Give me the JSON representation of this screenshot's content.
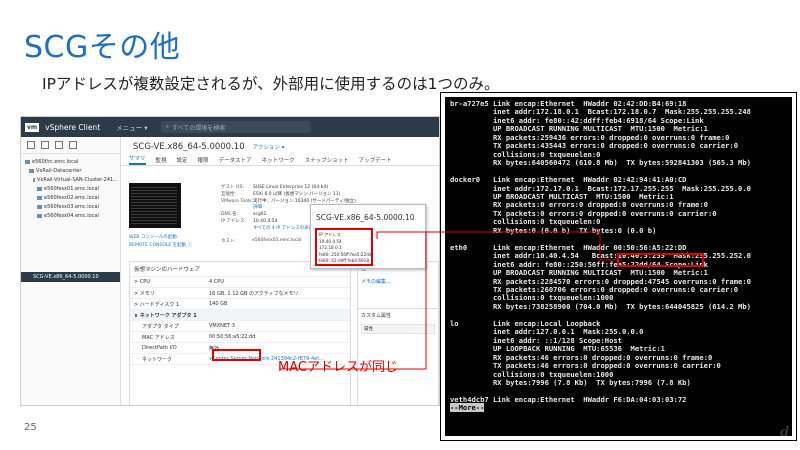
{
  "slide": {
    "title": "SCGその他",
    "subtitle": "IPアドレスが複数設定されるが、外部用に使用するのは1つのみ。",
    "page_number": "25",
    "annotation": "MACアドレスが同じ",
    "footer_glyph": "d"
  },
  "vsphere": {
    "logo": "vm",
    "app_name": "vSphere Client",
    "menu": "メニュー ▾",
    "search_placeholder": "すべての環境を検索",
    "tree": [
      "e560f/rc.emc.local",
      "VxRail-Datacenter",
      "VxRail-Virtual-SAN-Cluster-241...",
      "e560fesx01.emc.local",
      "e560fesx02.emc.local",
      "e560fesx03.emc.local",
      "e560fesx04.emc.local"
    ],
    "selected_vm": "SCG-VE.x86_64-5.0000.10",
    "vm_title": "SCG-VE.x86_64-5.0000.10",
    "actions": "アクション ▾",
    "tabs": [
      "サマリ",
      "監視",
      "設定",
      "権限",
      "データストア",
      "ネットワーク",
      "スナップショット",
      "アップデート"
    ],
    "web_console": "WEB コンソールの起動",
    "remote_console": "REMOTE CONSOLE を起動 ⓘ",
    "summary": [
      {
        "k": "ゲスト OS:",
        "v": "SUSE Linux Enterprise 12 (64-bit)"
      },
      {
        "k": "互換性:",
        "v": "ESXi 6.0 以降 (仮想マシン バージョン 11)"
      },
      {
        "k": "VMware Tools:",
        "v": "実行中、バージョン:10340 (サードパーティ/独立)"
      },
      {
        "k": "",
        "v": "詳細"
      },
      {
        "k": "DNS 名:",
        "v": "scg01"
      },
      {
        "k": "IP アドレス:",
        "v": "10.40.4.54"
      },
      {
        "k": "",
        "v": "すべての 4 IP アドレスの表示"
      }
    ],
    "host_label": "ホスト:",
    "host_value": "e560fesx03.emc.local",
    "hw_title": "仮想マシンのハードウェア",
    "hw_rows": [
      {
        "k": "> CPU",
        "v": "4 CPU"
      },
      {
        "k": "> メモリ",
        "v": "16 GB, 1.12 GB のアクティブなメモリ"
      },
      {
        "k": "> ハードディスク 1",
        "v": "140 GB"
      },
      {
        "k": "∨ ネットワーク アダプタ 1",
        "v": ""
      },
      {
        "k": "アダプタ タイプ",
        "v": "VMXNET 3"
      },
      {
        "k": "MAC アドレス",
        "v": "00:50:56:a5:22:dd"
      },
      {
        "k": "DirectPath I/O",
        "v": "無効"
      },
      {
        "k": "ネットワーク",
        "v": "vCenter Server Network-241394c2-f879-4ef..."
      }
    ],
    "side_note": "注",
    "side_edit": "メモの編集...",
    "side_custom": "カスタム属性",
    "side_attr": "属性",
    "popup_title": "SCG-VE.x86_64-5.0000.10",
    "popup_lines": [
      "IP アドレス",
      "10.40.4.54",
      "172.18.0.1",
      "fe80::250:56ff:fea5:22dd",
      "fe80::42:ddff:feb4:6918"
    ]
  },
  "terminal": {
    "lines": [
      "br-a727e5 Link encap:Ethernet  HWaddr 02:42:DD:B4:69:18",
      "          inet addr:172.18.0.1  Bcast:172.18.0.7  Mask:255.255.255.248",
      "          inet6 addr: fe80::42:ddff:feb4:6918/64 Scope:Link",
      "          UP BROADCAST RUNNING MULTICAST  MTU:1500  Metric:1",
      "          RX packets:259436 errors:0 dropped:0 overruns:0 frame:0",
      "          TX packets:435443 errors:0 dropped:0 overruns:0 carrier:0",
      "          collisions:0 txqueuelen:0",
      "          RX bytes:640560472 (610.8 Mb)  TX bytes:592841303 (565.3 Mb)",
      "",
      "docker0   Link encap:Ethernet  HWaddr 02:42:94:41:A0:CD",
      "          inet addr:172.17.0.1  Bcast:172.17.255.255  Mask:255.255.0.0",
      "          UP BROADCAST MULTICAST  MTU:1500  Metric:1",
      "          RX packets:0 errors:0 dropped:0 overruns:0 frame:0",
      "          TX packets:0 errors:0 dropped:0 overruns:0 carrier:0",
      "          collisions:0 txqueuelen:0",
      "          RX bytes:0 (0.0 b)  TX bytes:0 (0.0 b)",
      "",
      "eth0      Link encap:Ethernet  HWaddr 00:50:56:A5:22:DD",
      "          inet addr:10.40.4.54   Bcast:10.40.5.255  Mask:255.255.252.0",
      "          inet6 addr: fe80::250:56ff:fea5:22dd/64 Scope:Link",
      "          UP BROADCAST RUNNING MULTICAST  MTU:1500  Metric:1",
      "          RX packets:2284570 errors:0 dropped:47545 overruns:0 frame:0",
      "          TX packets:260706 errors:0 dropped:0 overruns:0 carrier:0",
      "          collisions:0 txqueuelen:1000",
      "          RX bytes:738258900 (704.0 Mb)  TX bytes:644045825 (614.2 Mb)",
      "",
      "lo        Link encap:Local Loopback",
      "          inet addr:127.0.0.1  Mask:255.0.0.0",
      "          inet6 addr: ::1/128 Scope:Host",
      "          UP LOOPBACK RUNNING  MTU:65536  Metric:1",
      "          RX packets:46 errors:0 dropped:0 overruns:0 frame:0",
      "          TX packets:46 errors:0 dropped:0 overruns:0 carrier:0",
      "          collisions:0 txqueuelen:1000",
      "          RX bytes:7996 (7.8 Kb)  TX bytes:7996 (7.8 Kb)",
      "",
      "veth4dcb7 Link encap:Ethernet  HWaddr F6:DA:04:03:03:72"
    ],
    "more": "--More--"
  },
  "colors": {
    "title": "#1f6fc0",
    "highlight": "#e00000",
    "terminal_bg": "#000000"
  }
}
